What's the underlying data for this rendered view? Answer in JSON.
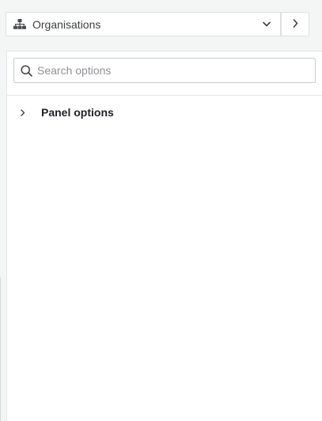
{
  "selector": {
    "label": "Organisations",
    "icon": "organisation-hierarchy-icon",
    "dropdown_icon": "chevron-down-icon"
  },
  "collapse_button": {
    "icon": "chevron-right-icon"
  },
  "search": {
    "placeholder": "Search options",
    "value": "",
    "icon": "search-icon"
  },
  "sections": [
    {
      "title": "Panel options",
      "expanded": false,
      "icon": "chevron-right-icon"
    }
  ],
  "colors": {
    "background": "#f4f5f5",
    "panel": "#ffffff",
    "border": "#dcdee1",
    "text": "#202226",
    "placeholder": "#8e9196"
  }
}
